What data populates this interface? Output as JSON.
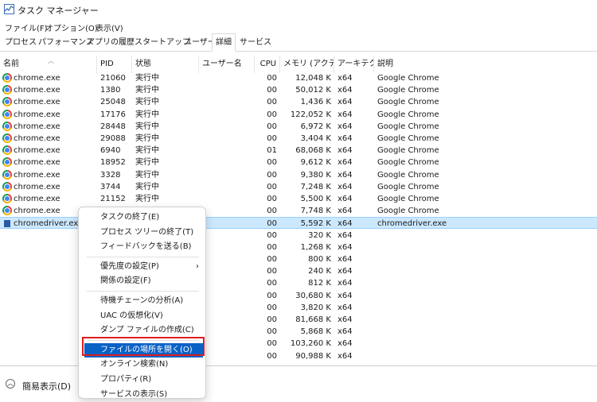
{
  "window": {
    "title": "タスク マネージャー"
  },
  "menu": [
    "ファイル(F)",
    "オプション(O)",
    "表示(V)"
  ],
  "tabs": [
    "プロセス",
    "パフォーマンス",
    "アプリの履歴",
    "スタートアップ",
    "ユーザー",
    "詳細",
    "サービス"
  ],
  "active_tab": "詳細",
  "columns": [
    "名前",
    "PID",
    "状態",
    "ユーザー名",
    "CPU",
    "メモリ (アクティ...",
    "アーキテク...",
    "説明"
  ],
  "rows": [
    {
      "name": "chrome.exe",
      "pid": "21060",
      "status": "実行中",
      "cpu": "00",
      "mem": "12,048 K",
      "arch": "x64",
      "desc": "Google Chrome"
    },
    {
      "name": "chrome.exe",
      "pid": "1380",
      "status": "実行中",
      "cpu": "00",
      "mem": "50,012 K",
      "arch": "x64",
      "desc": "Google Chrome"
    },
    {
      "name": "chrome.exe",
      "pid": "25048",
      "status": "実行中",
      "cpu": "00",
      "mem": "1,436 K",
      "arch": "x64",
      "desc": "Google Chrome"
    },
    {
      "name": "chrome.exe",
      "pid": "17176",
      "status": "実行中",
      "cpu": "00",
      "mem": "122,052 K",
      "arch": "x64",
      "desc": "Google Chrome"
    },
    {
      "name": "chrome.exe",
      "pid": "28448",
      "status": "実行中",
      "cpu": "00",
      "mem": "6,972 K",
      "arch": "x64",
      "desc": "Google Chrome"
    },
    {
      "name": "chrome.exe",
      "pid": "29088",
      "status": "実行中",
      "cpu": "00",
      "mem": "3,404 K",
      "arch": "x64",
      "desc": "Google Chrome"
    },
    {
      "name": "chrome.exe",
      "pid": "6940",
      "status": "実行中",
      "cpu": "01",
      "mem": "68,068 K",
      "arch": "x64",
      "desc": "Google Chrome"
    },
    {
      "name": "chrome.exe",
      "pid": "18952",
      "status": "実行中",
      "cpu": "00",
      "mem": "9,612 K",
      "arch": "x64",
      "desc": "Google Chrome"
    },
    {
      "name": "chrome.exe",
      "pid": "3328",
      "status": "実行中",
      "cpu": "00",
      "mem": "9,380 K",
      "arch": "x64",
      "desc": "Google Chrome"
    },
    {
      "name": "chrome.exe",
      "pid": "3744",
      "status": "実行中",
      "cpu": "00",
      "mem": "7,248 K",
      "arch": "x64",
      "desc": "Google Chrome"
    },
    {
      "name": "chrome.exe",
      "pid": "21152",
      "status": "実行中",
      "cpu": "00",
      "mem": "5,500 K",
      "arch": "x64",
      "desc": "Google Chrome"
    },
    {
      "name": "chrome.exe",
      "pid": "",
      "status": "",
      "cpu": "00",
      "mem": "7,748 K",
      "arch": "x64",
      "desc": "Google Chrome"
    },
    {
      "name": "chromedriver.exe",
      "pid": "",
      "status": "",
      "cpu": "00",
      "mem": "5,592 K",
      "arch": "x64",
      "desc": "chromedriver.exe",
      "selected": true
    },
    {
      "name": "",
      "pid": "",
      "status": "",
      "cpu": "00",
      "mem": "320 K",
      "arch": "x64",
      "desc": ""
    },
    {
      "name": "",
      "pid": "",
      "status": "",
      "cpu": "00",
      "mem": "1,268 K",
      "arch": "x64",
      "desc": ""
    },
    {
      "name": "",
      "pid": "",
      "status": "",
      "cpu": "00",
      "mem": "800 K",
      "arch": "x64",
      "desc": ""
    },
    {
      "name": "",
      "pid": "",
      "status": "",
      "cpu": "00",
      "mem": "240 K",
      "arch": "x64",
      "desc": ""
    },
    {
      "name": "",
      "pid": "",
      "status": "",
      "cpu": "00",
      "mem": "812 K",
      "arch": "x64",
      "desc": ""
    },
    {
      "name": "",
      "pid": "",
      "status": "",
      "cpu": "00",
      "mem": "30,680 K",
      "arch": "x64",
      "desc": ""
    },
    {
      "name": "",
      "pid": "",
      "status": "",
      "cpu": "00",
      "mem": "3,820 K",
      "arch": "x64",
      "desc": ""
    },
    {
      "name": "",
      "pid": "",
      "status": "",
      "cpu": "00",
      "mem": "81,668 K",
      "arch": "x64",
      "desc": ""
    },
    {
      "name": "",
      "pid": "",
      "status": "",
      "cpu": "00",
      "mem": "5,868 K",
      "arch": "x64",
      "desc": ""
    },
    {
      "name": "",
      "pid": "",
      "status": "",
      "cpu": "00",
      "mem": "103,260 K",
      "arch": "x64",
      "desc": ""
    },
    {
      "name": "",
      "pid": "",
      "status": "",
      "cpu": "00",
      "mem": "90,988 K",
      "arch": "x64",
      "desc": ""
    }
  ],
  "context_menu": [
    {
      "label": "タスクの終了(E)",
      "group": 0
    },
    {
      "label": "プロセス ツリーの終了(T)",
      "group": 0
    },
    {
      "label": "フィードバックを送る(B)",
      "group": 0
    },
    {
      "label": "優先度の設定(P)",
      "group": 1,
      "submenu": true
    },
    {
      "label": "関係の設定(F)",
      "group": 1
    },
    {
      "label": "待機チェーンの分析(A)",
      "group": 2
    },
    {
      "label": "UAC の仮想化(V)",
      "group": 2
    },
    {
      "label": "ダンプ ファイルの作成(C)",
      "group": 2
    },
    {
      "label": "ファイルの場所を開く(O)",
      "group": 3,
      "highlight": true
    },
    {
      "label": "オンライン検索(N)",
      "group": 3
    },
    {
      "label": "プロパティ(R)",
      "group": 3
    },
    {
      "label": "サービスの表示(S)",
      "group": 3
    }
  ],
  "bottom": {
    "label": "簡易表示(D)"
  },
  "colors": {
    "highlight": "#0a62c6",
    "selection": "#cce8ff",
    "callout": "#e11c1c"
  }
}
